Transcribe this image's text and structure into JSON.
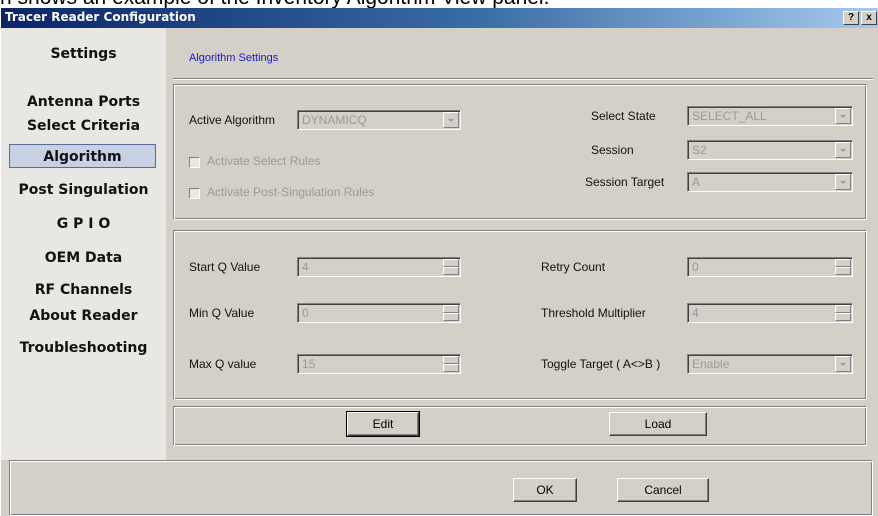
{
  "caption": "n shows an example of the Inventory Algorithm View panel.",
  "window": {
    "title": "Tracer Reader Configuration",
    "help_label": "?",
    "close_label": "x"
  },
  "sidebar": {
    "items": [
      {
        "label": "Settings"
      },
      {
        "label": "Antenna Ports"
      },
      {
        "label": "Select Criteria"
      },
      {
        "label": "Algorithm",
        "selected": true
      },
      {
        "label": "Post Singulation"
      },
      {
        "label": "G P I O"
      },
      {
        "label": "OEM Data"
      },
      {
        "label": "RF Channels"
      },
      {
        "label": "About Reader"
      },
      {
        "label": "Troubleshooting"
      }
    ]
  },
  "main": {
    "section_title": "Algorithm Settings",
    "algorithm": {
      "active_algorithm_label": "Active Algorithm",
      "active_algorithm_value": "DYNAMICQ",
      "activate_select_rules_label": "Activate Select Rules",
      "activate_post_singulation_rules_label": "Activate Post-Singulation Rules",
      "select_state_label": "Select State",
      "select_state_value": "SELECT_ALL",
      "session_label": "Session",
      "session_value": "S2",
      "session_target_label": "Session Target",
      "session_target_value": "A"
    },
    "params": {
      "start_q_label": "Start Q Value",
      "start_q_value": "4",
      "min_q_label": "Min Q Value",
      "min_q_value": "0",
      "max_q_label": "Max Q value",
      "max_q_value": "15",
      "retry_count_label": "Retry Count",
      "retry_count_value": "0",
      "threshold_label": "Threshold Multiplier",
      "threshold_value": "4",
      "toggle_target_label": "Toggle Target ( A<>B )",
      "toggle_target_value": "Enable"
    },
    "actions": {
      "edit_label": "Edit",
      "load_label": "Load"
    }
  },
  "footer": {
    "ok_label": "OK",
    "cancel_label": "Cancel"
  },
  "colors": {
    "title_bar": "#0a246a",
    "dialog_face": "#d4d0c8",
    "sidebar_bg": "#e9e7e3",
    "link_blue": "#1818c8"
  }
}
